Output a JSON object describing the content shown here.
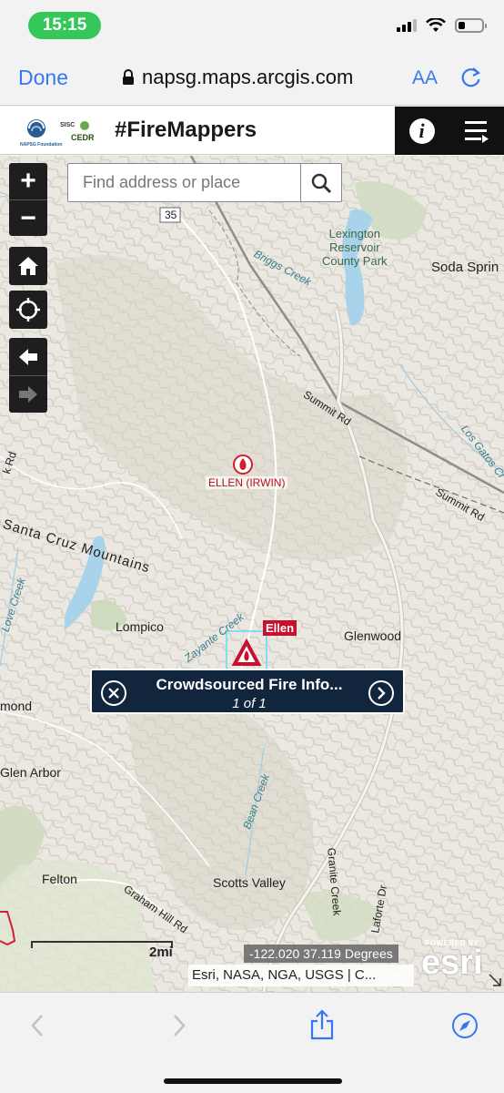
{
  "status_bar": {
    "time": "15:15"
  },
  "browser": {
    "done_label": "Done",
    "url": "napsg.maps.arcgis.com",
    "text_size_label": "AA"
  },
  "header": {
    "logo_text": "NAPSG Foundation",
    "logo_sub1": "SISC",
    "logo_sub2": "CEDR",
    "title": "#FireMappers"
  },
  "search": {
    "placeholder": "Find address or place"
  },
  "map": {
    "zoom_in": "+",
    "zoom_out": "−",
    "labels": {
      "route": "35",
      "reservoir": "Lexington\nReservoir\nCounty Park",
      "briggs": "Briggs Creek",
      "soda": "Soda Sprin",
      "summit1": "Summit Rd",
      "summit2": "Summit Rd",
      "los_gatos": "Los Gatos Cr",
      "santa_cruz": "Santa Cruz Mountains",
      "love_creek": "Love Creek",
      "lompico": "Lompico",
      "zayante": "Zayante Creek",
      "glenwood": "Glenwood",
      "mond": "mond",
      "glen_arbor": "Glen Arbor",
      "bean": "Bean Creek",
      "felton": "Felton",
      "scotts_valley": "Scotts Valley",
      "graham": "Graham Hill Rd",
      "granite": "Granite Creek",
      "laforte": "Laforte Dr",
      "k_rd": "k Rd"
    },
    "fire_label": "ELLEN (IRWIN)",
    "incident_tag": "Ellen",
    "popup": {
      "title": "Crowdsourced Fire Info...",
      "count": "1 of 1"
    },
    "scale_label": "2mi",
    "coordinates": "-122.020 37.119 Degrees",
    "attribution": "Esri, NASA, NGA, USGS | C...",
    "powered_by": "POWERED BY",
    "esri": "esri"
  },
  "colors": {
    "accent_blue": "#3478f6",
    "fire_red": "#c8102e",
    "popup_bg": "#11253d",
    "status_green": "#34c759"
  }
}
